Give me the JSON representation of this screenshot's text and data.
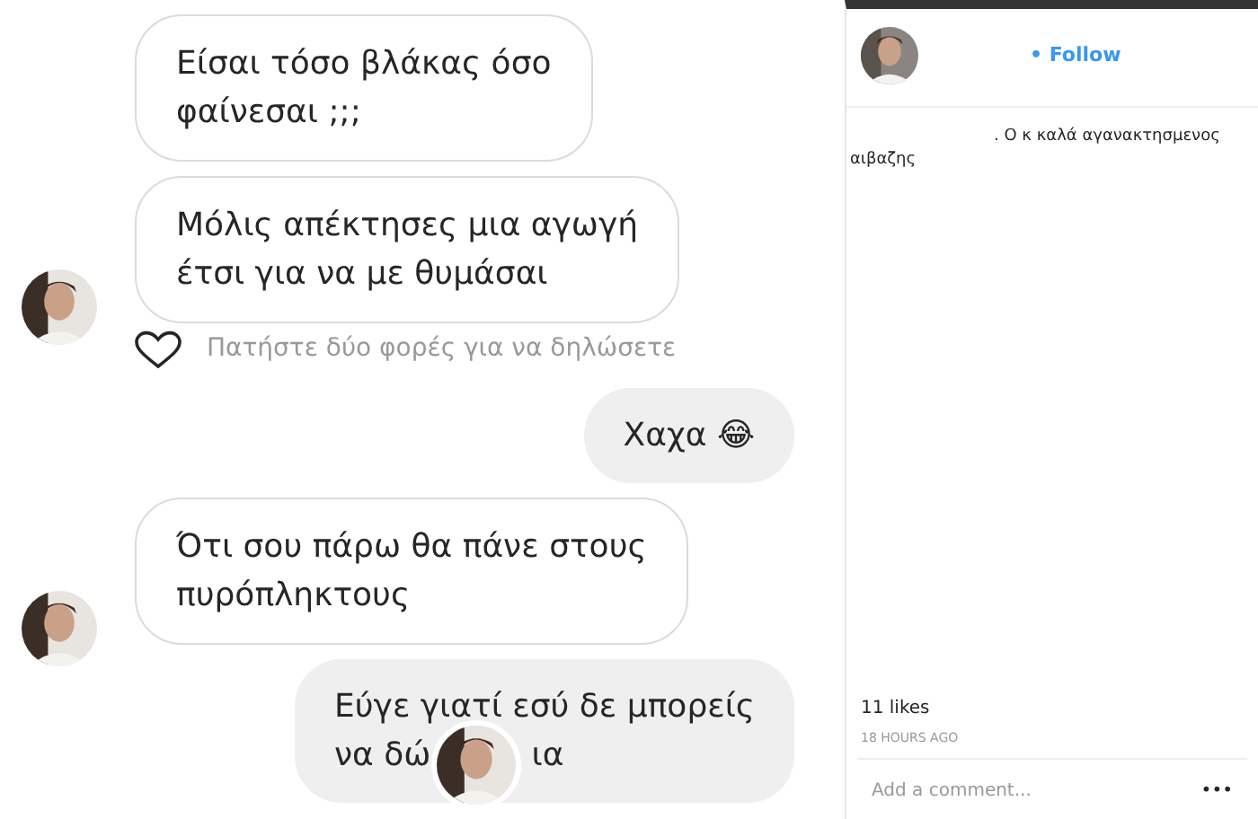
{
  "messages": [
    {
      "kind": "incoming",
      "lines": [
        "Είσαι τόσο βλάκας όσο",
        "φαίνεσαι ;;;"
      ],
      "avatar": false
    },
    {
      "kind": "incoming",
      "lines": [
        "Μόλις απέκτησες μια αγωγή",
        "έτσι για να με θυμάσαι"
      ],
      "avatar": true
    },
    {
      "kind": "like_hint",
      "text": "Πατήστε δύο φορές για να δηλώσετε"
    },
    {
      "kind": "outgoing",
      "lines": [
        "Χαχα 😂"
      ]
    },
    {
      "kind": "incoming",
      "lines": [
        "Ότι σου πάρω θα πάνε στους",
        "πυρόπληκτους"
      ],
      "avatar": true
    },
    {
      "kind": "outgoing",
      "lines": [
        "Εύγε γιατί εσύ δε μπορείς"
      ],
      "covered_line": {
        "before": "να δώ",
        "after": "ια"
      }
    }
  ],
  "post": {
    "follow": "• Follow",
    "caption": ". Ο κ καλά αγανακτησμενος αιβαζης",
    "likes": "11 likes",
    "time": "18 HOURS AGO",
    "comment_placeholder": "Add a comment...",
    "more": "•••"
  }
}
